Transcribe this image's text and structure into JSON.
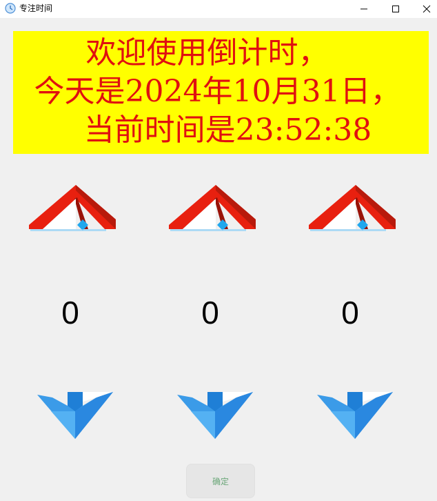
{
  "window": {
    "title": "专注时间",
    "icon": "app-clock-icon"
  },
  "banner": {
    "line1": "欢迎使用倒计时，",
    "line2": "今天是2024年10月31日，",
    "line3": "当前时间是23:52:38",
    "text_color": "#e01010",
    "background": "#ffff00"
  },
  "counters": [
    {
      "value": "0"
    },
    {
      "value": "0"
    },
    {
      "value": "0"
    }
  ],
  "confirm_button": {
    "label": "确定"
  }
}
